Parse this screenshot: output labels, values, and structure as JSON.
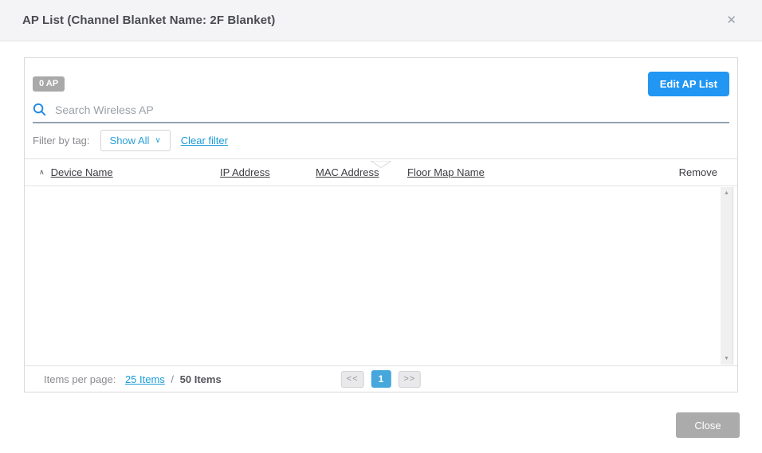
{
  "dialog": {
    "title": "AP List (Channel Blanket Name: 2F Blanket)",
    "close_icon": "✕"
  },
  "toolbar": {
    "ap_count_badge": "0 AP",
    "edit_ap_list_button": "Edit AP List"
  },
  "search": {
    "placeholder": "Search Wireless AP"
  },
  "filter": {
    "label": "Filter by tag:",
    "dropdown_value": "Show All",
    "dropdown_caret": "∨",
    "clear_filter_link": "Clear filter"
  },
  "table": {
    "sort_icon": "∧",
    "columns": [
      "Device Name",
      "IP Address",
      "MAC Address",
      "Floor Map Name",
      "Remove"
    ],
    "rows": [],
    "scrollbar": {
      "up_icon": "▲",
      "down_icon": "▼"
    }
  },
  "footer": {
    "items_per_page_label": "Items per page:",
    "page_size_link": "25 Items",
    "separator": " / ",
    "total_items": "50 Items",
    "pagination": {
      "prev": "<<",
      "page": "1",
      "next": ">>"
    }
  },
  "actions": {
    "close_button": "Close"
  },
  "colors": {
    "accent_blue": "#2196f3",
    "link_blue": "#1a9cd8",
    "pagination_active_blue": "#45a7db",
    "neutral_gray": "#ababab"
  }
}
